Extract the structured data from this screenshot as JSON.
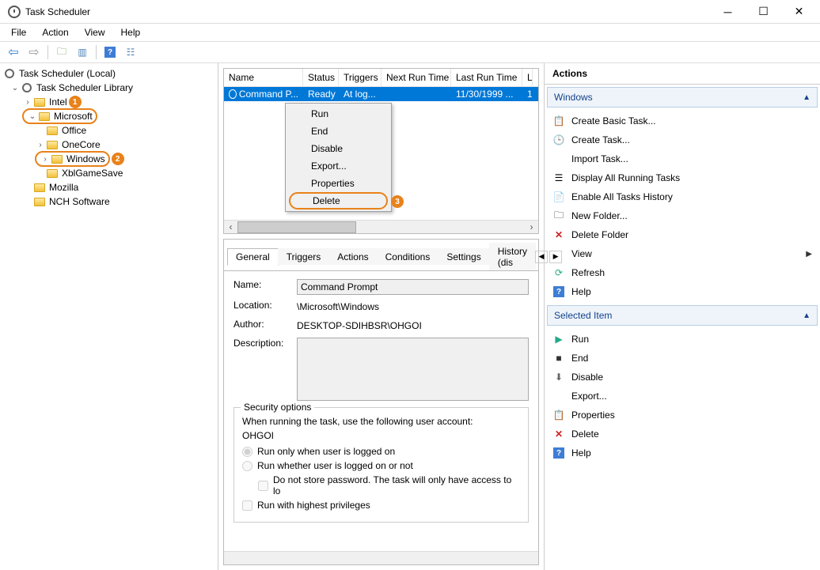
{
  "window": {
    "title": "Task Scheduler"
  },
  "menubar": {
    "file": "File",
    "action": "Action",
    "view": "View",
    "help": "Help"
  },
  "tree": {
    "root": "Task Scheduler (Local)",
    "library": "Task Scheduler Library",
    "intel": "Intel",
    "microsoft": "Microsoft",
    "office": "Office",
    "onecore": "OneCore",
    "windows": "Windows",
    "xblgamesave": "XblGameSave",
    "mozilla": "Mozilla",
    "nch": "NCH Software"
  },
  "badges": {
    "b1": "1",
    "b2": "2",
    "b3": "3"
  },
  "grid": {
    "headers": {
      "name": "Name",
      "status": "Status",
      "triggers": "Triggers",
      "next": "Next Run Time",
      "last": "Last Run Time",
      "r": "L"
    },
    "rows": [
      {
        "name": "Command P...",
        "status": "Ready",
        "triggers": "At log...",
        "next": "",
        "last": "11/30/1999 ...",
        "r": "1"
      }
    ]
  },
  "context": {
    "run": "Run",
    "end": "End",
    "disable": "Disable",
    "export": "Export...",
    "properties": "Properties",
    "delete": "Delete"
  },
  "tabs": {
    "general": "General",
    "triggers": "Triggers",
    "actions": "Actions",
    "conditions": "Conditions",
    "settings": "Settings",
    "history": "History (dis"
  },
  "details": {
    "name_label": "Name:",
    "name_value": "Command Prompt",
    "location_label": "Location:",
    "location_value": "\\Microsoft\\Windows",
    "author_label": "Author:",
    "author_value": "DESKTOP-SDIHBSR\\OHGOI",
    "description_label": "Description:",
    "security_title": "Security options",
    "security_text": "When running the task, use the following user account:",
    "security_user": "OHGOI",
    "radio1": "Run only when user is logged on",
    "radio2": "Run whether user is logged on or not",
    "check1": "Do not store password.  The task will only have access to lo",
    "check2": "Run with highest privileges"
  },
  "actions": {
    "title": "Actions",
    "section1": "Windows",
    "items1": {
      "create_basic": "Create Basic Task...",
      "create_task": "Create Task...",
      "import": "Import Task...",
      "display_running": "Display All Running Tasks",
      "enable_history": "Enable All Tasks History",
      "new_folder": "New Folder...",
      "delete_folder": "Delete Folder",
      "view": "View",
      "refresh": "Refresh",
      "help": "Help"
    },
    "section2": "Selected Item",
    "items2": {
      "run": "Run",
      "end": "End",
      "disable": "Disable",
      "export": "Export...",
      "properties": "Properties",
      "delete": "Delete",
      "help": "Help"
    }
  }
}
